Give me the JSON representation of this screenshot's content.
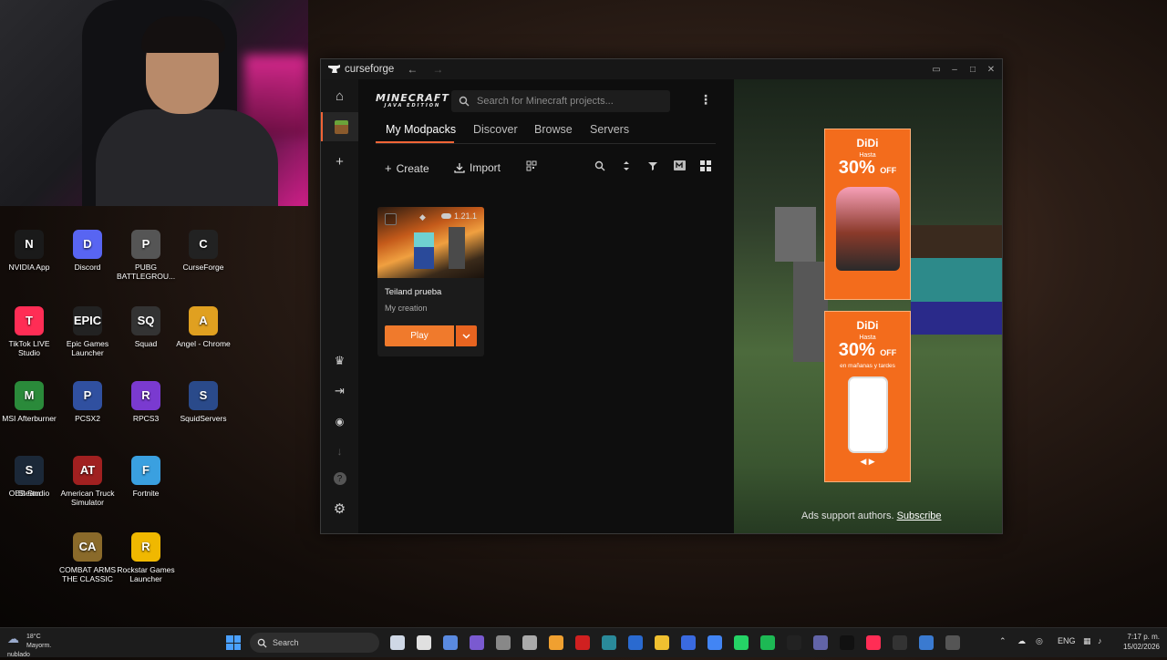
{
  "desktop": {
    "icons": [
      {
        "label": "NVIDIA App",
        "color": "#1a1a1a",
        "glyph": "N"
      },
      {
        "label": "Discord",
        "color": "#5865f2",
        "glyph": "D"
      },
      {
        "label": "PUBG BATTLEGROU...",
        "color": "#555555",
        "glyph": "P"
      },
      {
        "label": "CurseForge",
        "color": "#222222",
        "glyph": "C"
      },
      {
        "label": "TikTok LIVE Studio",
        "color": "#ff2d55",
        "glyph": "T"
      },
      {
        "label": "Epic Games Launcher",
        "color": "#222222",
        "glyph": "EPIC"
      },
      {
        "label": "Squad",
        "color": "#333333",
        "glyph": "SQ"
      },
      {
        "label": "Angel - Chrome",
        "color": "#e0a020",
        "glyph": "A"
      },
      {
        "label": "MSI Afterburner",
        "color": "#2a8a3a",
        "glyph": "M"
      },
      {
        "label": "PCSX2",
        "color": "#3050a0",
        "glyph": "P"
      },
      {
        "label": "RPCS3",
        "color": "#7a3ad0",
        "glyph": "R"
      },
      {
        "label": "SquidServers",
        "color": "#2a4a8a",
        "glyph": "S"
      },
      {
        "label": "OBS Studio",
        "color": "#303030",
        "glyph": "O"
      },
      {
        "label": "American Truck Simulator",
        "color": "#a02020",
        "glyph": "AT"
      },
      {
        "label": "Fortnite",
        "color": "#3aa0e0",
        "glyph": "F"
      },
      {
        "label": "Steam",
        "color": "#1b2838",
        "glyph": "S"
      },
      {
        "label": "COMBAT ARMS THE CLASSIC",
        "color": "#8a6a2a",
        "glyph": "CA"
      },
      {
        "label": "Rockstar Games Launcher",
        "color": "#f0b800",
        "glyph": "R"
      }
    ]
  },
  "window": {
    "title": "curseforge",
    "back": "←",
    "forward": "→",
    "controls": {
      "layout": "▭",
      "minimize": "–",
      "maximize": "□",
      "close": "✕"
    }
  },
  "sidebar": {
    "home": "⌂",
    "add": "+",
    "crown": "♛",
    "login": "⇥",
    "discord": "◉",
    "download": "↓",
    "help": "?",
    "settings": "⚙"
  },
  "header": {
    "game_logo": "MINECRAFT",
    "game_edition": "JAVA EDITION",
    "search_placeholder": "Search for Minecraft projects...",
    "menu": "⋮"
  },
  "tabs": [
    {
      "label": "My Modpacks",
      "active": true
    },
    {
      "label": "Discover",
      "active": false
    },
    {
      "label": "Browse",
      "active": false
    },
    {
      "label": "Servers",
      "active": false
    }
  ],
  "toolbar": {
    "create_label": "Create",
    "import_label": "Import"
  },
  "modpack": {
    "name": "Teiland prueba",
    "author": "My creation",
    "version": "1.21.1",
    "play_label": "Play",
    "dropdown": "⌄"
  },
  "ads": {
    "brand": "DiDi",
    "ad1": {
      "hasta": "Hasta",
      "percent": "30%",
      "off": "OFF"
    },
    "ad2": {
      "hasta": "Hasta",
      "percent": "30%",
      "off": "OFF",
      "note": "en mañanas y tardes"
    },
    "support_text": "Ads support authors.",
    "subscribe_label": "Subscribe"
  },
  "taskbar": {
    "temperature": "18°C",
    "weather": "Mayorm. nublado",
    "search_label": "Search",
    "language": "ENG",
    "time": "7:17 p. m.",
    "date": "15/02/2026"
  }
}
